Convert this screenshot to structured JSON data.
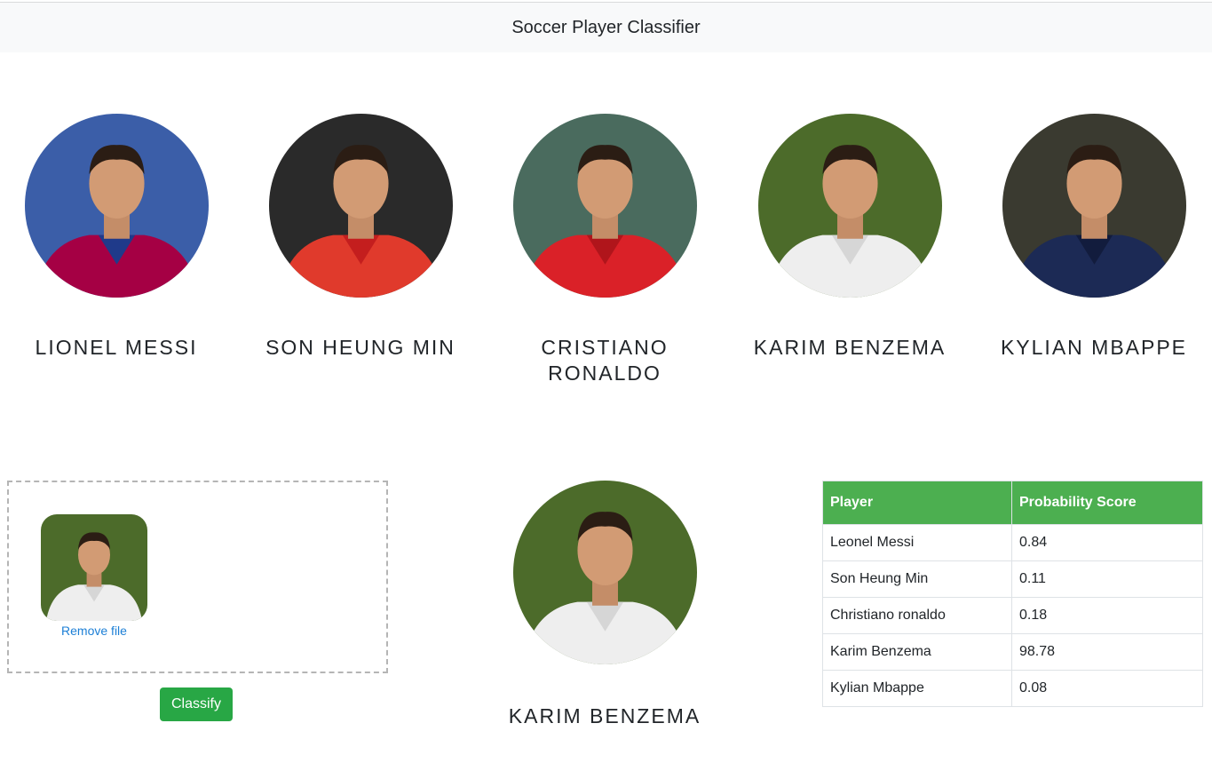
{
  "navbar": {
    "title": "Soccer Player Classifier"
  },
  "players": [
    {
      "name": "Lionel Messi",
      "kit": "#a50044",
      "kit2": "#1f3a8a",
      "bg": "#3b5ea8"
    },
    {
      "name": "Son Heung Min",
      "kit": "#e03a2c",
      "kit2": "#c41e1e",
      "bg": "#2a2a2a"
    },
    {
      "name": "Cristiano Ronaldo",
      "kit": "#da2128",
      "kit2": "#b0151b",
      "bg": "#4a6b5e"
    },
    {
      "name": "Karim Benzema",
      "kit": "#eeeeee",
      "kit2": "#d6d6d6",
      "bg": "#4c6b2a"
    },
    {
      "name": "Kylian Mbappe",
      "kit": "#1c2a55",
      "kit2": "#121c3d",
      "bg": "#3a3a30"
    }
  ],
  "upload": {
    "remove_label": "Remove file",
    "classify_label": "Classify"
  },
  "result": {
    "name": "Karim Benzema"
  },
  "table": {
    "headers": [
      "Player",
      "Probability Score"
    ],
    "rows": [
      [
        "Leonel Messi",
        "0.84"
      ],
      [
        "Son Heung Min",
        "0.11"
      ],
      [
        "Christiano ronaldo",
        "0.18"
      ],
      [
        "Karim Benzema",
        "98.78"
      ],
      [
        "Kylian Mbappe",
        "0.08"
      ]
    ]
  }
}
